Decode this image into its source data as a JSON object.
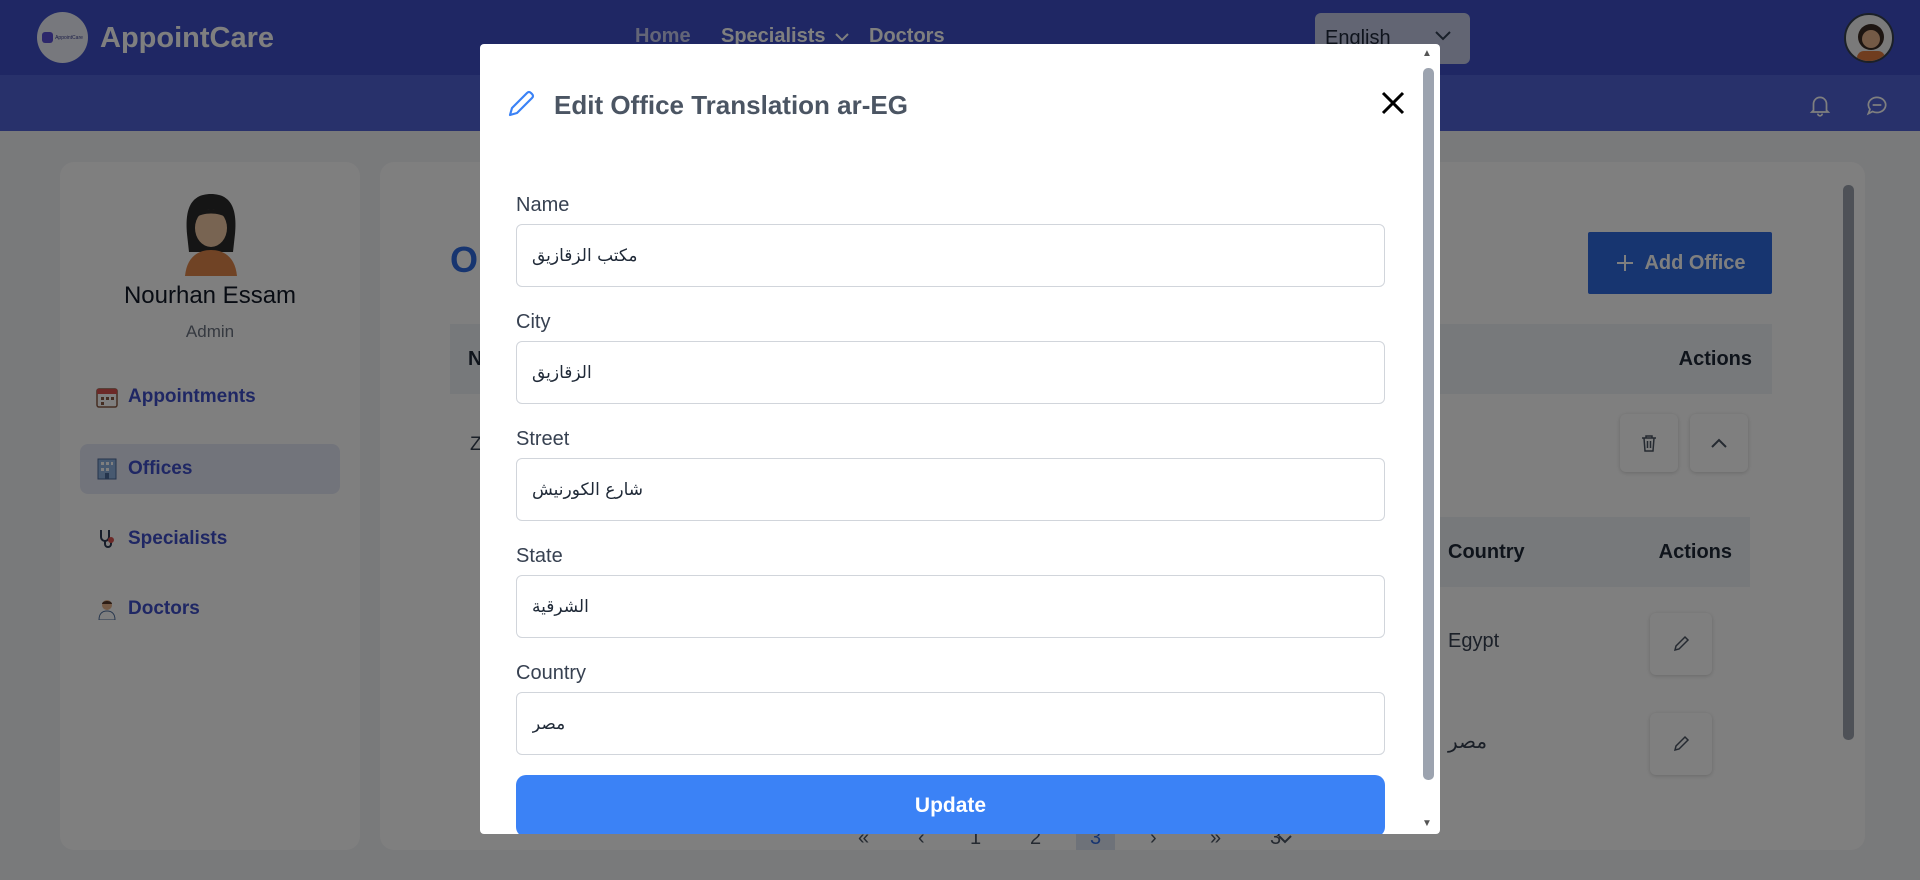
{
  "app": {
    "name": "AppointCare",
    "logo_text": "AppointCare"
  },
  "topnav": {
    "items": [
      {
        "label": "Home"
      },
      {
        "label": "Specialists"
      },
      {
        "label": "Doctors"
      }
    ],
    "language": {
      "selected": "English"
    }
  },
  "sidebar": {
    "user_name": "Nourhan Essam",
    "user_role": "Admin",
    "items": [
      {
        "label": "Appointments",
        "icon": "calendar-icon",
        "active": false
      },
      {
        "label": "Offices",
        "icon": "office-building-icon",
        "active": true
      },
      {
        "label": "Specialists",
        "icon": "stethoscope-icon",
        "active": false
      },
      {
        "label": "Doctors",
        "icon": "doctor-icon",
        "active": false
      }
    ]
  },
  "main": {
    "title_partial": "O",
    "add_button": "Add Office",
    "table": {
      "first_col_partial": "N",
      "actions": "Actions",
      "row_partial": "Z"
    },
    "translations": {
      "country_header": "Country",
      "actions_header": "Actions",
      "rows": [
        {
          "country": "Egypt"
        },
        {
          "country": "مصر"
        }
      ]
    },
    "pagination": {
      "first": "«",
      "prev": "‹",
      "pages": [
        "1",
        "2",
        "3"
      ],
      "current": "3",
      "next": "›",
      "last": "»",
      "page_size": "3"
    }
  },
  "modal": {
    "title": "Edit Office Translation ar-EG",
    "fields": [
      {
        "label": "Name",
        "value": "مكتب الزقازيق"
      },
      {
        "label": "City",
        "value": "الزقازيق"
      },
      {
        "label": "Street",
        "value": "شارع الكورنيش"
      },
      {
        "label": "State",
        "value": "الشرقية"
      },
      {
        "label": "Country",
        "value": "مصر"
      }
    ],
    "submit": "Update"
  },
  "colors": {
    "topbar": "#3f4fc8",
    "subbar": "#5062d6",
    "primary": "#2f6be0",
    "update_button": "#3b82f6"
  }
}
